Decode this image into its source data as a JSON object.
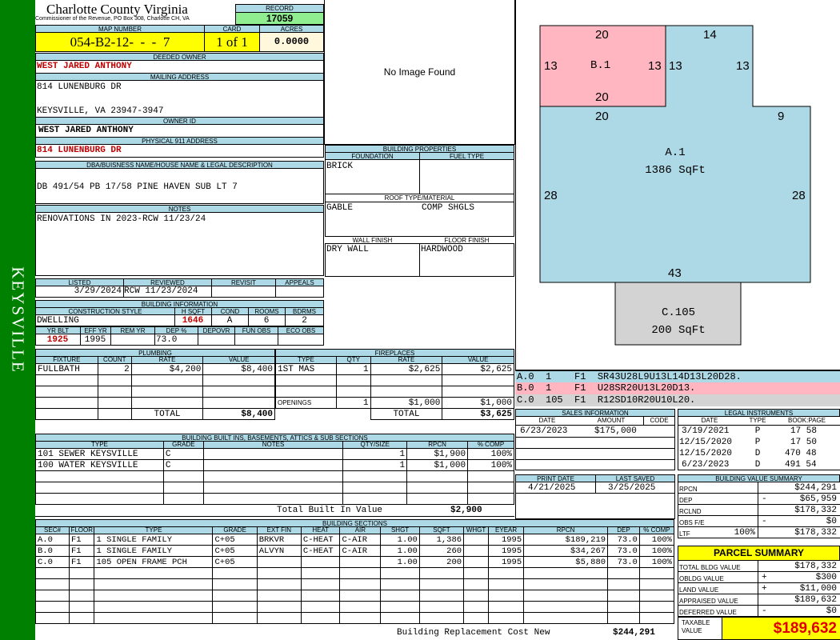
{
  "sidebar_text": "KEYSVILLE",
  "county": {
    "title": "Charlotte County Virginia",
    "subtitle": "Commissioner of the Revenue, PO Box 308, Charlotte CH, VA"
  },
  "record": {
    "label": "RECORD",
    "value": "17059"
  },
  "map": {
    "label": "MAP NUMBER",
    "value": "054-B2-12-  -  -  7",
    "card_label": "CARD",
    "card_value": "1 of 1",
    "acres_label": "ACRES",
    "acres_value": "0.0000"
  },
  "owner": {
    "deeded_label": "DEEDED OWNER",
    "deeded": "WEST JARED ANTHONY",
    "mailing_label": "MAILING ADDRESS",
    "mailing1": "814 LUNENBURG DR",
    "mailing2": "KEYSVILLE, VA 23947-3947",
    "ownerid_label": "OWNER ID",
    "ownerid": "WEST JARED ANTHONY",
    "physical_label": "PHYSICAL 911 ADDRESS",
    "physical": "814 LUNENBURG DR"
  },
  "legal": {
    "label": "DBA/BUISNESS NAME/HOUSE NAME & LEGAL DESCRIPTION",
    "value": "DB 491/54 PB 17/58 PINE HAVEN SUB LT 7"
  },
  "notes": {
    "label": "NOTES",
    "value": "RENOVATIONS IN 2023-RCW 11/23/24"
  },
  "image": {
    "text": "No Image Found"
  },
  "building_props": {
    "title": "BUILDING PROPERTIES",
    "foundation_label": "FOUNDATION",
    "foundation": "BRICK",
    "fuel_label": "FUEL TYPE",
    "fuel": "",
    "roof_label": "ROOF TYPE/MATERIAL",
    "roof_type": "GABLE",
    "roof_material": "COMP SHGLS",
    "wall_label": "WALL FINISH",
    "wall": "DRY WALL",
    "floor_label": "FLOOR FINISH",
    "floor": "HARDWOOD"
  },
  "status": {
    "listed_label": "LISTED",
    "listed": "3/29/2024",
    "reviewed_label": "REVIEWED",
    "reviewed": "RCW 11/23/2024",
    "revisit_label": "REVISIT",
    "appeals_label": "APPEALS"
  },
  "building_info": {
    "title": "BUILDING INFORMATION",
    "style_label": "CONSTRUCTION STYLE",
    "style": "DWELLING",
    "hsqft_label": "H SQFT",
    "hsqft": "1646",
    "cond_label": "COND",
    "cond": "A",
    "rooms_label": "ROOMS",
    "rooms": "6",
    "bdrms_label": "BDRMS",
    "bdrms": "2",
    "yrblt_label": "YR BLT",
    "yrblt": "1925",
    "effyr_label": "EFF YR",
    "effyr": "1995",
    "remyr_label": "REM YR",
    "remyr": "",
    "dep_label": "DEP %",
    "dep": "73.0",
    "depovr_label": "DEPOVR",
    "funobs_label": "FUN OBS",
    "ecoobs_label": "ECO OBS"
  },
  "plumbing": {
    "title": "PLUMBING",
    "headers": [
      "FIXTURE",
      "COUNT",
      "RATE",
      "VALUE"
    ],
    "rows": [
      [
        "FULLBATH",
        "2",
        "$4,200",
        "$8,400"
      ]
    ],
    "total_label": "TOTAL",
    "total": "$8,400"
  },
  "fireplaces": {
    "title": "FIREPLACES",
    "headers": [
      "TYPE",
      "QTY",
      "RATE",
      "VALUE"
    ],
    "rows": [
      [
        "1ST MAS",
        "1",
        "$2,625",
        "$2,625"
      ]
    ],
    "openings_label": "OPENINGS",
    "openings_qty": "1",
    "openings_rate": "$1,000",
    "openings_value": "$1,000",
    "total_label": "TOTAL",
    "total": "$3,625"
  },
  "builtins": {
    "title": "BUILDING BUILT INS, BASEMENTS, ATTICS & SUB SECTIONS",
    "headers": [
      "TYPE",
      "GRADE",
      "NOTES",
      "QTY/SIZE",
      "RPCN",
      "% COMP"
    ],
    "rows": [
      [
        "101 SEWER KEYSVILLE",
        "C",
        "",
        "1",
        "$1,900",
        "100%"
      ],
      [
        "100 WATER KEYSVILLE",
        "C",
        "",
        "1",
        "$1,000",
        "100%"
      ]
    ],
    "total_label": "Total Built In Value",
    "total": "$2,900"
  },
  "sections": {
    "title": "BUILDING SECTIONS",
    "headers": [
      "SEC#",
      "FLOOR",
      "TYPE",
      "GRADE",
      "EXT FIN",
      "HEAT",
      "AIR",
      "SHGT",
      "SQFT",
      "WHGT",
      "EYEAR",
      "RPCN",
      "DEP",
      "% COMP"
    ],
    "rows": [
      [
        "A.0",
        "F1",
        "1 SINGLE FAMILY",
        "C+05",
        "BRKVR",
        "C-HEAT",
        "C-AIR",
        "1.00",
        "1,386",
        "",
        "1995",
        "$189,219",
        "73.0",
        "100%"
      ],
      [
        "B.0",
        "F1",
        "1 SINGLE FAMILY",
        "C+05",
        "ALVYN",
        "C-HEAT",
        "C-AIR",
        "1.00",
        "260",
        "",
        "1995",
        "$34,267",
        "73.0",
        "100%"
      ],
      [
        "C.0",
        "F1",
        "105 OPEN FRAME PCH",
        "C+05",
        "",
        "",
        "",
        "1.00",
        "200",
        "",
        "1995",
        "$5,880",
        "73.0",
        "100%"
      ]
    ],
    "total_label": "Building Replacement Cost New",
    "total": "$244,291"
  },
  "sketch": {
    "b_label": "B.1",
    "a_label": "A.1",
    "a_area": "1386 SqFt",
    "c_label": "C.105",
    "c_area": "200 SqFt",
    "dims": {
      "b_top": "20",
      "b_left": "13",
      "b_right": "13",
      "b_bottom": "20",
      "a_top_mid": "20",
      "a_step": "14",
      "a_left_upper": "13",
      "a_right_upper": "13",
      "a_notch": "9",
      "a_left": "28",
      "a_right": "28",
      "a_bottom": "43"
    },
    "a_color": "#add8e6",
    "b_color": "#ffb6c1",
    "c_color": "#d3d3d3",
    "traces": [
      {
        "code": "A.0  1    F1  SR43U28L9U13L14D13L20D28.",
        "color": "#add8e6"
      },
      {
        "code": "B.0  1    F1  U28SR20U13L20D13.",
        "color": "#ffb6c1"
      },
      {
        "code": "C.0  105  F1  R12SD10R20U10L20.",
        "color": "#d3d3d3"
      }
    ]
  },
  "sales": {
    "title": "SALES INFORMATION",
    "headers": [
      "DATE",
      "AMOUNT",
      "CODE"
    ],
    "rows": [
      [
        "6/23/2023",
        "$175,000",
        ""
      ]
    ]
  },
  "legal_instr": {
    "title": "LEGAL INSTRUMENTS",
    "headers": [
      "DATE",
      "TYPE",
      "BOOK:PAGE"
    ],
    "rows": [
      [
        "3/19/2021",
        "P",
        "17 58"
      ],
      [
        "12/15/2020",
        "P",
        "17 50"
      ],
      [
        "12/15/2020",
        "D",
        "470 48"
      ],
      [
        "6/23/2023",
        "D",
        "491 54"
      ]
    ]
  },
  "print": {
    "print_label": "PRINT DATE",
    "print_date": "4/21/2025",
    "saved_label": "LAST SAVED",
    "saved_date": "3/25/2025"
  },
  "bvs": {
    "title": "BUILDING VALUE SUMMARY",
    "rows": [
      {
        "label": "RPCN",
        "sign": "",
        "value": "$244,291"
      },
      {
        "label": "DEP",
        "sign": "-",
        "value": "$65,959"
      },
      {
        "label": "RCLND",
        "sign": "",
        "value": "$178,332"
      },
      {
        "label": "OBS F/E",
        "sign": "-",
        "value": "$0"
      },
      {
        "label": "LTF",
        "sign": "100%",
        "value": "$178,332"
      }
    ]
  },
  "parcel": {
    "title": "PARCEL SUMMARY",
    "rows": [
      {
        "label": "TOTAL BLDG VALUE",
        "sign": "",
        "value": "$178,332"
      },
      {
        "label": "OBLDG VALUE",
        "sign": "+",
        "value": "$300"
      },
      {
        "label": "LAND VALUE",
        "sign": "+",
        "value": "$11,000"
      },
      {
        "label": "APPRAISED VALUE",
        "sign": "",
        "value": "$189,632"
      },
      {
        "label": "DEFERRED VALUE",
        "sign": "-",
        "value": "$0"
      }
    ],
    "taxable_label": "TAXABLE VALUE",
    "taxable": "$189,632"
  }
}
